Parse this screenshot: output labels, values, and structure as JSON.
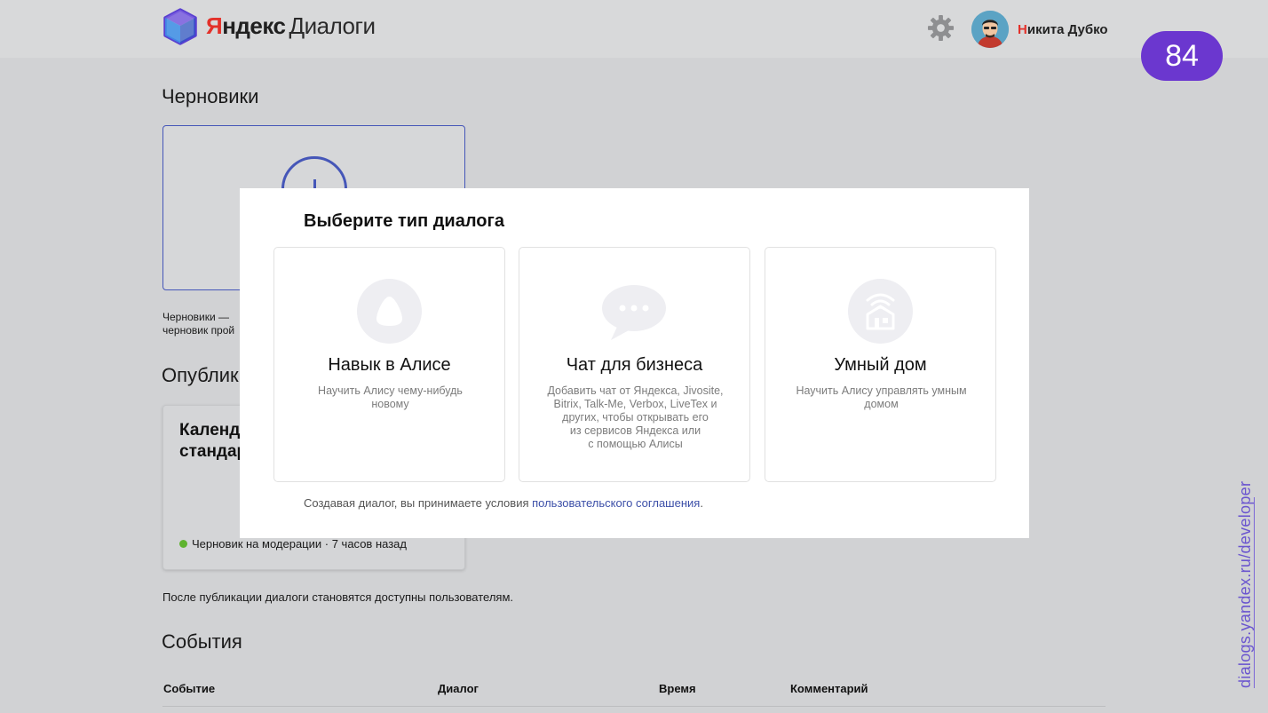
{
  "header": {
    "brand_yandex_first": "Я",
    "brand_yandex_rest": "ндекс",
    "brand_product": "Диалоги",
    "user_initial": "Н",
    "user_name_rest": "икита Дубко",
    "slide_number": "84"
  },
  "drafts": {
    "title": "Черновики",
    "note_line1": "Черновики —",
    "note_line2": "черновик прой"
  },
  "published": {
    "title": "Опублик",
    "card_name_line1": "Календ",
    "card_name_line2": "стандар",
    "card_status": "Черновик на модерации · 7 часов назад",
    "note": "После публикации диалоги становятся доступны пользователям."
  },
  "events": {
    "title": "События",
    "columns": [
      "Событие",
      "Диалог",
      "Время",
      "Комментарий"
    ]
  },
  "modal": {
    "title": "Выберите тип диалога",
    "cards": [
      {
        "title": "Навык в Алисе",
        "desc_lines": [
          "Научить Алису чему-нибудь",
          "новому"
        ],
        "icon": "alice-icon"
      },
      {
        "title": "Чат для бизнеса",
        "desc_lines": [
          "Добавить чат от Яндекса, Jivosite,",
          "Bitrix, Talk-Me, Verbox, LiveTex и",
          "других, чтобы открывать его",
          "из сервисов Яндекса или",
          "с помощью Алисы"
        ],
        "icon": "chat-bubble-icon"
      },
      {
        "title": "Умный дом",
        "desc_lines": [
          "Научить Алису управлять умным",
          "домом"
        ],
        "icon": "smart-home-icon"
      }
    ],
    "terms_prefix": "Создавая диалог, вы принимаете условия ",
    "terms_link": "пользовательского соглашения",
    "terms_suffix": "."
  },
  "side_url": "dialogs.yandex.ru/developer",
  "colors": {
    "background": "#d1d2d4",
    "accent_blue": "#4556b8",
    "slide_badge": "#6b37cf",
    "brand_red": "#e3312a",
    "status_green": "#5fb32f"
  }
}
